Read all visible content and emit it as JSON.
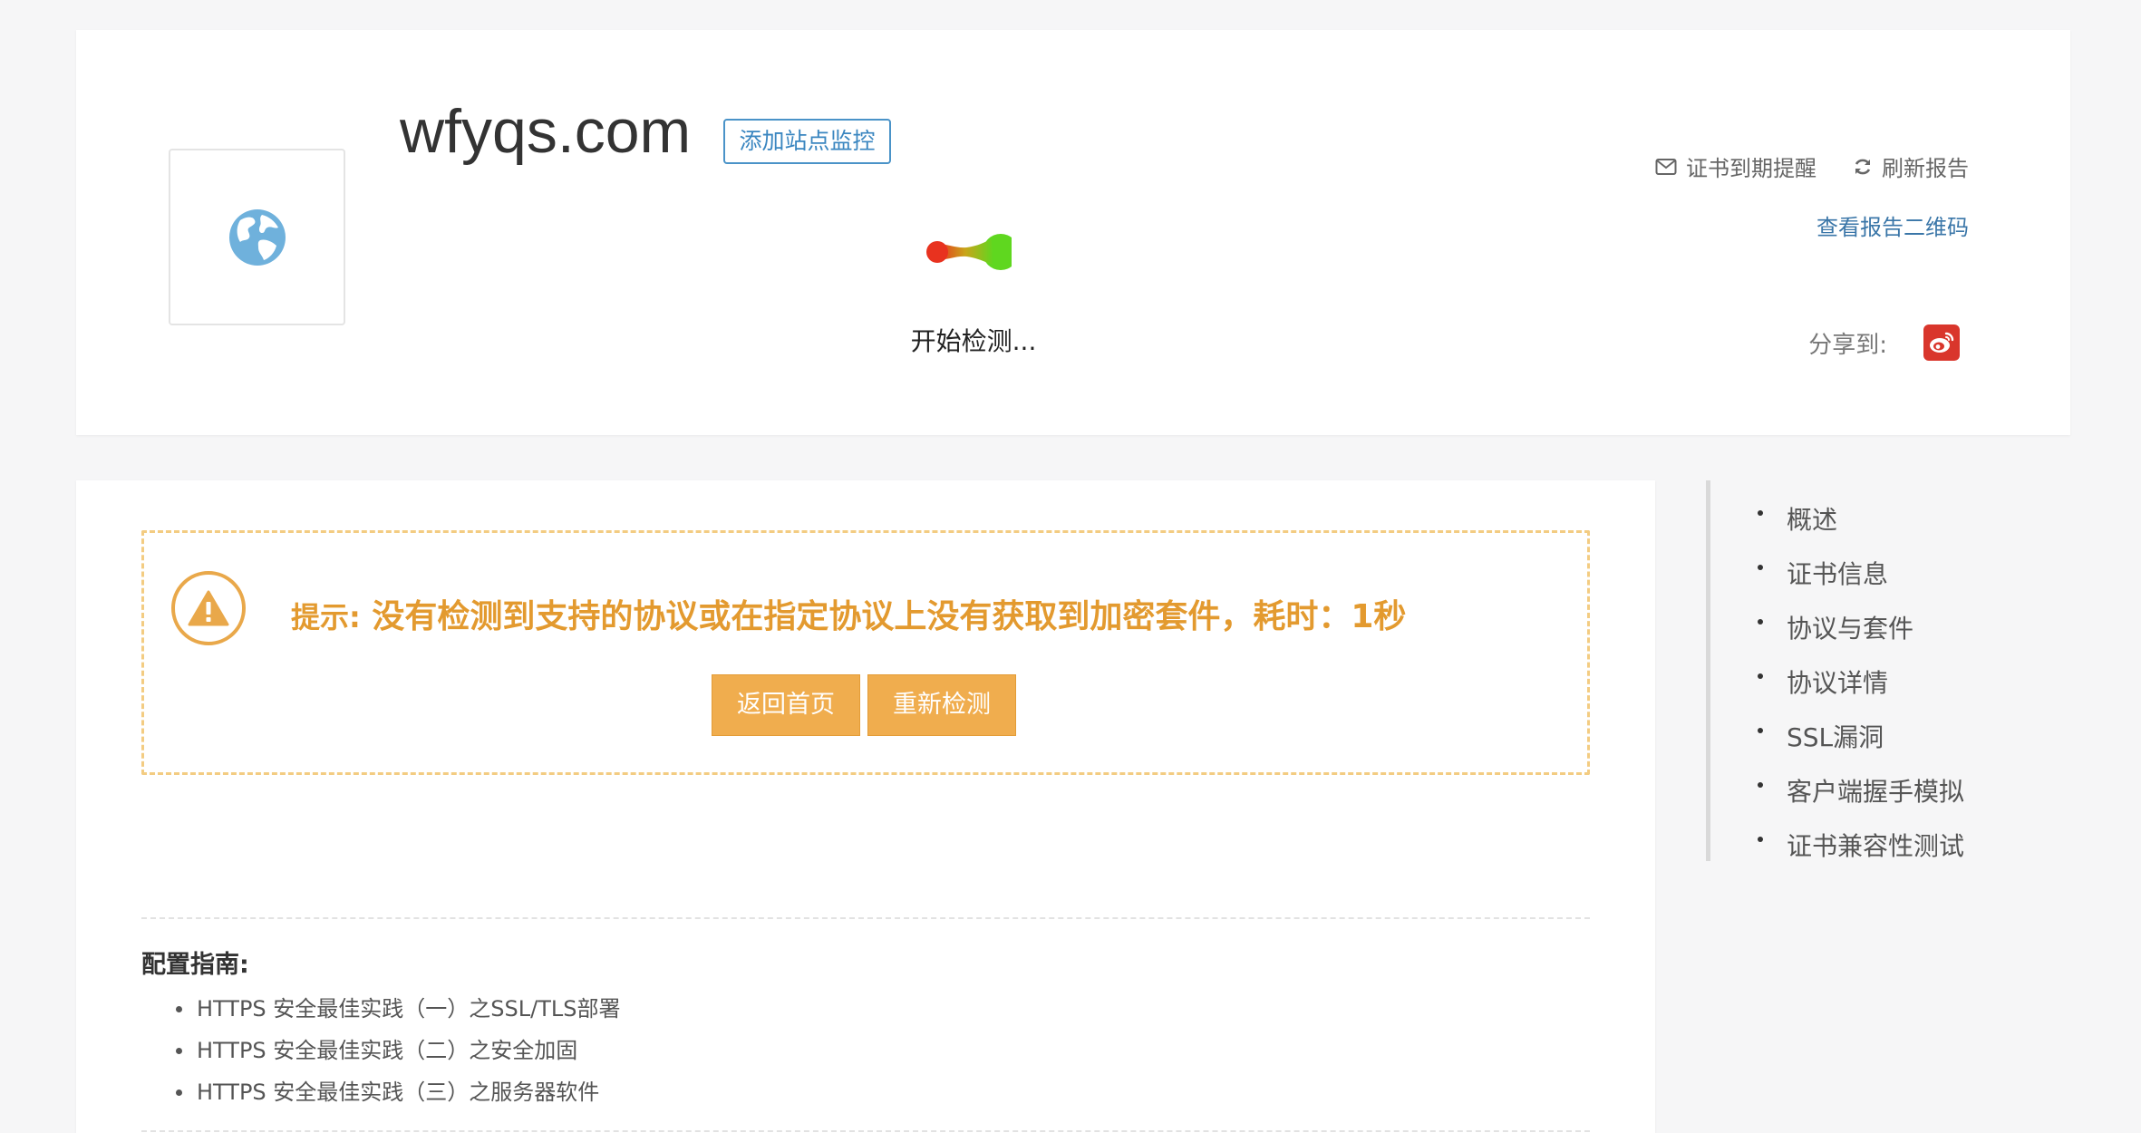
{
  "header": {
    "domain": "wfyqs.com",
    "add_monitor_label": "添加站点监控",
    "loading_text": "开始检测...",
    "cert_reminder_label": "证书到期提醒",
    "refresh_label": "刷新报告",
    "qrcode_label": "查看报告二维码",
    "share_label": "分享到:"
  },
  "warning": {
    "prefix": "提示:",
    "message": "没有检测到支持的协议或在指定协议上没有获取到加密套件，耗时：1秒",
    "back_home_label": "返回首页",
    "recheck_label": "重新检测"
  },
  "guide": {
    "title": "配置指南:",
    "items": [
      "HTTPS 安全最佳实践（一）之SSL/TLS部署",
      "HTTPS 安全最佳实践（二）之安全加固",
      "HTTPS 安全最佳实践（三）之服务器软件"
    ]
  },
  "side_nav": {
    "items": [
      "概述",
      "证书信息",
      "协议与套件",
      "协议详情",
      "SSL漏洞",
      "客户端握手模拟",
      "证书兼容性测试"
    ]
  },
  "colors": {
    "accent_blue": "#3a86c0",
    "warning_orange": "#e39a2f",
    "button_orange": "#f0ad4e",
    "weibo_red": "#d9362c"
  },
  "icons": [
    "globe-icon",
    "mail-icon",
    "refresh-icon",
    "weibo-icon",
    "warning-icon"
  ]
}
